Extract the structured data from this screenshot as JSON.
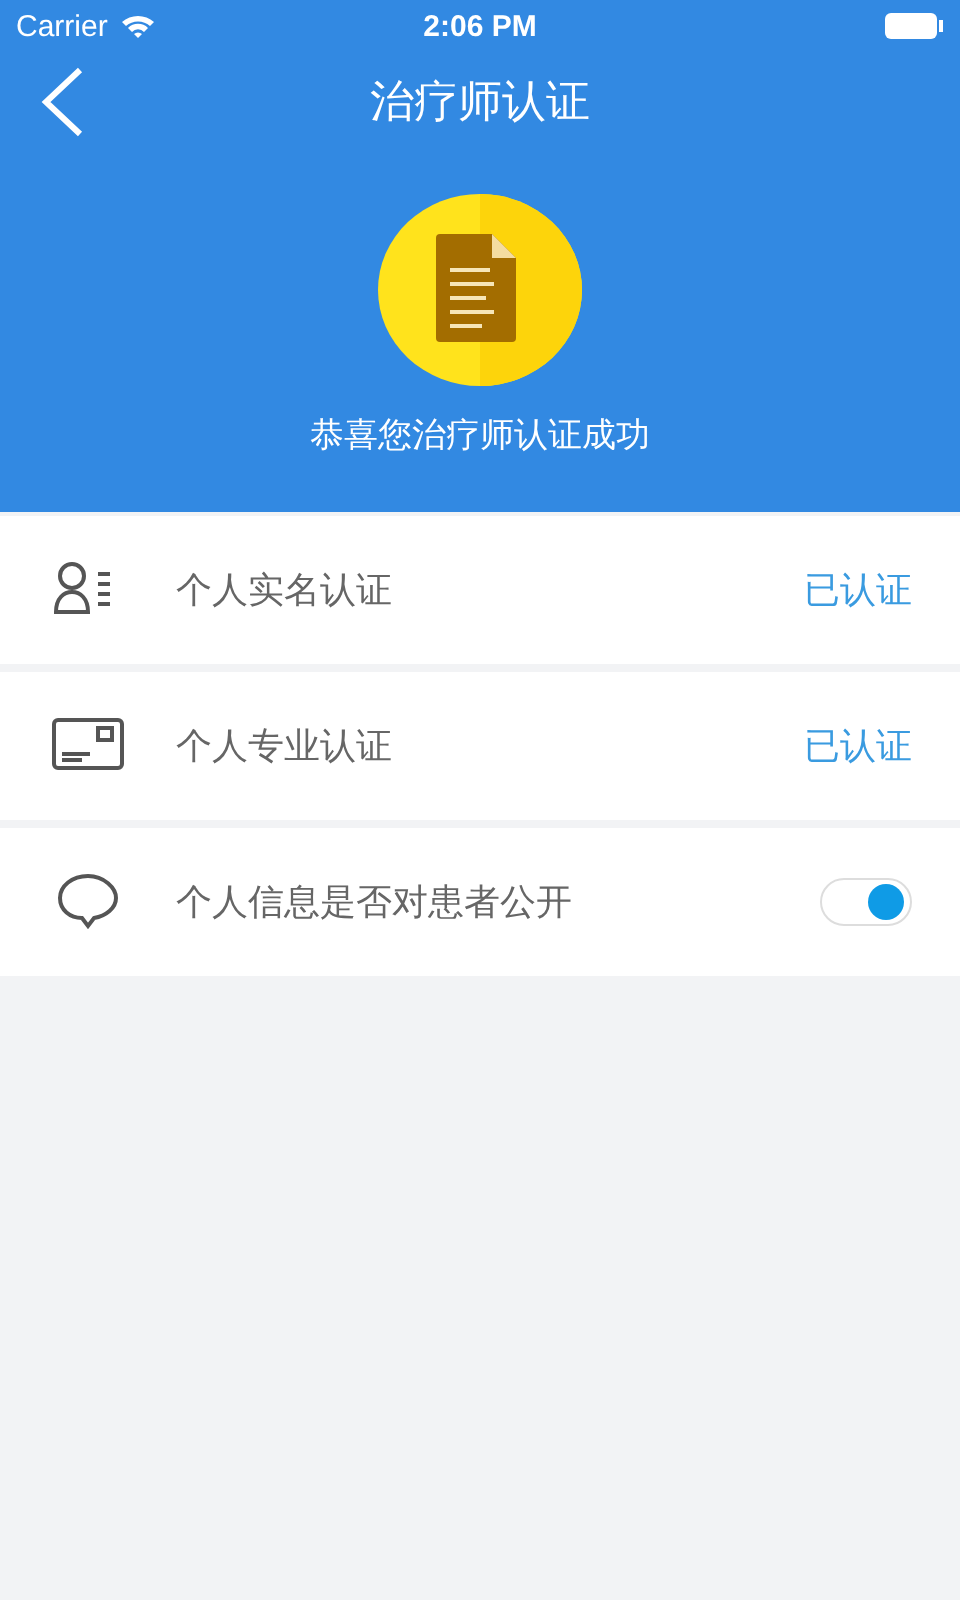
{
  "status_bar": {
    "carrier": "Carrier",
    "time": "2:06 PM"
  },
  "header": {
    "title": "治疗师认证",
    "message": "恭喜您治疗师认证成功"
  },
  "rows": [
    {
      "kind": "status",
      "label": "个人实名认证",
      "status": "已认证"
    },
    {
      "kind": "status",
      "label": "个人专业认证",
      "status": "已认证"
    },
    {
      "kind": "toggle",
      "label": "个人信息是否对患者公开",
      "on": true
    }
  ]
}
